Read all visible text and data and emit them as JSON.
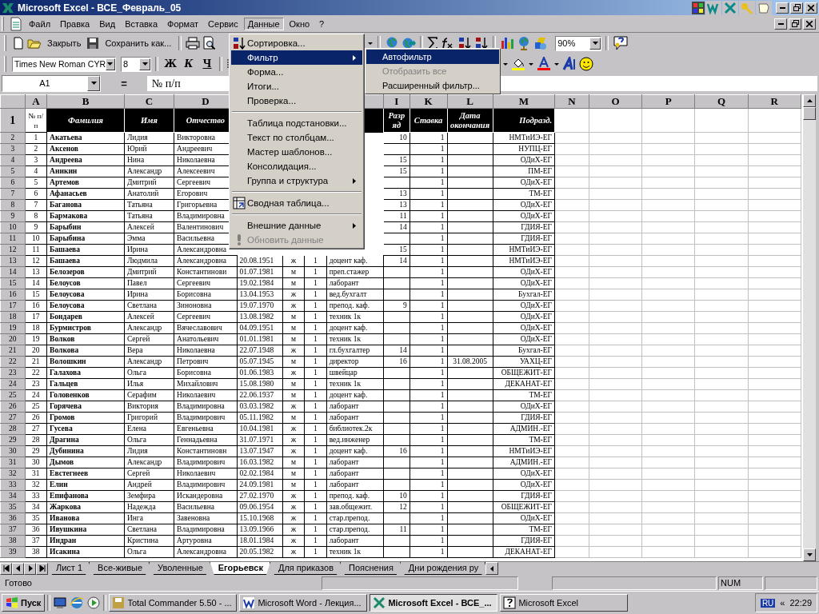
{
  "window": {
    "title": "Microsoft Excel - ВСЕ_Февраль_05"
  },
  "menu_bar": [
    {
      "label": "Файл",
      "selected": false
    },
    {
      "label": "Правка",
      "selected": false
    },
    {
      "label": "Вид",
      "selected": false
    },
    {
      "label": "Вставка",
      "selected": false
    },
    {
      "label": "Формат",
      "selected": false
    },
    {
      "label": "Сервис",
      "selected": false
    },
    {
      "label": "Данные",
      "selected": true
    },
    {
      "label": "Окно",
      "selected": false
    },
    {
      "label": "?",
      "selected": false
    }
  ],
  "standard_toolbar": {
    "close_label": "Закрыть",
    "save_as_label": "Сохранить как...",
    "zoom": "90%"
  },
  "formatting_toolbar": {
    "font": "Times New Roman CYR",
    "size": "8",
    "bold": "Ж",
    "italic": "К",
    "underline": "Ч"
  },
  "formula_bar": {
    "name_box": "A1",
    "equals": "=",
    "content": "№ п/п"
  },
  "sheet": {
    "column_letters_left": [
      "A",
      "B",
      "C",
      "D"
    ],
    "column_letters_right": [
      "I",
      "K",
      "L",
      "M",
      "N",
      "O",
      "P",
      "Q",
      "R"
    ],
    "header_row": {
      "number": "1",
      "cells": [
        "№ п/п",
        "Фамилия",
        "Имя",
        "Отчество",
        null,
        null,
        null,
        null,
        "Разряд",
        "Ставка",
        "Дата окончания",
        "Подразд."
      ]
    },
    "rows": [
      {
        "number": "2",
        "cells": [
          "1",
          "Акатьева",
          "Лидия",
          "Викторовна",
          null,
          null,
          null,
          null,
          "10",
          "1",
          null,
          "НМТиИЭ-ЕГ"
        ]
      },
      {
        "number": "3",
        "cells": [
          "2",
          "Аксенов",
          "Юрий",
          "Андреевич",
          null,
          null,
          null,
          null,
          null,
          "1",
          null,
          "НУПЦ-ЕГ"
        ]
      },
      {
        "number": "4",
        "cells": [
          "3",
          "Андреева",
          "Нина",
          "Николаевна",
          null,
          null,
          null,
          null,
          "15",
          "1",
          null,
          "ОДиХ-ЕГ"
        ]
      },
      {
        "number": "5",
        "cells": [
          "4",
          "Аникин",
          "Александр",
          "Алексеевич",
          null,
          null,
          null,
          null,
          "15",
          "1",
          null,
          "ПМ-ЕГ"
        ]
      },
      {
        "number": "6",
        "cells": [
          "5",
          "Артемов",
          "Дмитрий",
          "Сергеевич",
          null,
          null,
          null,
          null,
          null,
          "1",
          null,
          "ОДиХ-ЕГ"
        ]
      },
      {
        "number": "7",
        "cells": [
          "6",
          "Афанасьев",
          "Анатолий",
          "Егорович",
          null,
          null,
          null,
          null,
          "13",
          "1",
          null,
          "ТМ-ЕГ"
        ]
      },
      {
        "number": "8",
        "cells": [
          "7",
          "Баганова",
          "Татьяна",
          "Григорьевна",
          null,
          null,
          null,
          null,
          "13",
          "1",
          null,
          "ОДиХ-ЕГ"
        ]
      },
      {
        "number": "9",
        "cells": [
          "8",
          "Бармакова",
          "Татьяна",
          "Владимировна",
          null,
          null,
          null,
          null,
          "11",
          "1",
          null,
          "ОДиХ-ЕГ"
        ]
      },
      {
        "number": "10",
        "cells": [
          "9",
          "Барыбин",
          "Алексей",
          "Валентинович",
          null,
          null,
          null,
          null,
          "14",
          "1",
          null,
          "ГДИЯ-ЕГ"
        ]
      },
      {
        "number": "11",
        "cells": [
          "10",
          "Барыбина",
          "Эмма",
          "Васильевна",
          null,
          null,
          null,
          null,
          null,
          "1",
          null,
          "ГДИЯ-ЕГ"
        ]
      },
      {
        "number": "12",
        "cells": [
          "11",
          "Башаева",
          "Ирина",
          "Александровна",
          null,
          null,
          null,
          null,
          "15",
          "1",
          null,
          "НМТиИЭ-ЕГ"
        ]
      },
      {
        "number": "13",
        "cells": [
          "12",
          "Башаева",
          "Людмила",
          "Александровна",
          "20.08.1951",
          "ж",
          "1",
          "доцент каф.",
          "14",
          "1",
          null,
          "НМТиИЭ-ЕГ"
        ]
      },
      {
        "number": "14",
        "cells": [
          "13",
          "Белозеров",
          "Дмитрий",
          "Константинови",
          "01.07.1981",
          "м",
          "1",
          "преп.стажер",
          null,
          "1",
          null,
          "ОДиХ-ЕГ"
        ]
      },
      {
        "number": "15",
        "cells": [
          "14",
          "Белоусов",
          "Павел",
          "Сергеевич",
          "19.02.1984",
          "м",
          "1",
          "лаборант",
          null,
          "1",
          null,
          "ОДиХ-ЕГ"
        ]
      },
      {
        "number": "16",
        "cells": [
          "15",
          "Белоусова",
          "Ирина",
          "Борисовна",
          "13.04.1953",
          "ж",
          "1",
          "вед.бухгалт",
          null,
          "1",
          null,
          "Бухгал-ЕГ"
        ]
      },
      {
        "number": "17",
        "cells": [
          "16",
          "Белоусова",
          "Светлана",
          "Зиноновна",
          "19.07.1970",
          "ж",
          "1",
          "препод. каф.",
          "9",
          "1",
          null,
          "ОДиХ-ЕГ"
        ]
      },
      {
        "number": "18",
        "cells": [
          "17",
          "Бондарев",
          "Алексей",
          "Сергеевич",
          "13.08.1982",
          "м",
          "1",
          "техник 1к",
          null,
          "1",
          null,
          "ОДиХ-ЕГ"
        ]
      },
      {
        "number": "19",
        "cells": [
          "18",
          "Бурмистров",
          "Александр",
          "Вячеславович",
          "04.09.1951",
          "м",
          "1",
          "доцент каф.",
          null,
          "1",
          null,
          "ОДиХ-ЕГ"
        ]
      },
      {
        "number": "20",
        "cells": [
          "19",
          "Волков",
          "Сергей",
          "Анатольевич",
          "01.01.1981",
          "м",
          "1",
          "техник 1к",
          null,
          "1",
          null,
          "ОДиХ-ЕГ"
        ]
      },
      {
        "number": "21",
        "cells": [
          "20",
          "Волкова",
          "Вера",
          "Николаевна",
          "22.07.1948",
          "ж",
          "1",
          "гл.бухгалтер",
          "14",
          "1",
          null,
          "Бухгал-ЕГ"
        ]
      },
      {
        "number": "22",
        "cells": [
          "21",
          "Волошкин",
          "Александр",
          "Петрович",
          "05.07.1945",
          "м",
          "1",
          "директор",
          "16",
          "1",
          "31.08.2005",
          "УАХЦ-ЕГ"
        ]
      },
      {
        "number": "23",
        "cells": [
          "22",
          "Галахова",
          "Ольга",
          "Борисовна",
          "01.06.1983",
          "ж",
          "1",
          "швейцар",
          null,
          "1",
          null,
          "ОБЩЕЖИТ-ЕГ"
        ]
      },
      {
        "number": "24",
        "cells": [
          "23",
          "Гальцев",
          "Илья",
          "Михайлович",
          "15.08.1980",
          "м",
          "1",
          "техник 1к",
          null,
          "1",
          null,
          "ДЕКАНАТ-ЕГ"
        ]
      },
      {
        "number": "25",
        "cells": [
          "24",
          "Головенков",
          "Серафим",
          "Николаевич",
          "22.06.1937",
          "м",
          "1",
          "доцент каф.",
          null,
          "1",
          null,
          "ТМ-ЕГ"
        ]
      },
      {
        "number": "26",
        "cells": [
          "25",
          "Горячева",
          "Виктория",
          "Владимировна",
          "03.03.1982",
          "ж",
          "1",
          "лаборант",
          null,
          "1",
          null,
          "ОДиХ-ЕГ"
        ]
      },
      {
        "number": "27",
        "cells": [
          "26",
          "Громов",
          "Григорий",
          "Владимирович",
          "05.11.1982",
          "м",
          "1",
          "лаборант",
          null,
          "1",
          null,
          "ГДИЯ-ЕГ"
        ]
      },
      {
        "number": "28",
        "cells": [
          "27",
          "Гусева",
          "Елена",
          "Евгеньевна",
          "10.04.1981",
          "ж",
          "1",
          "библиотек.2к",
          null,
          "1",
          null,
          "АДМИН.-ЕГ"
        ]
      },
      {
        "number": "29",
        "cells": [
          "28",
          "Драгина",
          "Ольга",
          "Геннадьевна",
          "31.07.1971",
          "ж",
          "1",
          "вед.инженер",
          null,
          "1",
          null,
          "ТМ-ЕГ"
        ]
      },
      {
        "number": "30",
        "cells": [
          "29",
          "Дубинина",
          "Лидия",
          "Константиновн",
          "13.07.1947",
          "ж",
          "1",
          "доцент каф.",
          "16",
          "1",
          null,
          "НМТиИЭ-ЕГ"
        ]
      },
      {
        "number": "31",
        "cells": [
          "30",
          "Дымов",
          "Александр",
          "Владимирович",
          "16.03.1982",
          "м",
          "1",
          "лаборант",
          null,
          "1",
          null,
          "АДМИН.-ЕГ"
        ]
      },
      {
        "number": "32",
        "cells": [
          "31",
          "Евстегнеев",
          "Сергей",
          "Николаевич",
          "02.02.1984",
          "м",
          "1",
          "лаборант",
          null,
          "1",
          null,
          "ОДиХ-ЕГ"
        ]
      },
      {
        "number": "33",
        "cells": [
          "32",
          "Елин",
          "Андрей",
          "Владимирович",
          "24.09.1981",
          "м",
          "1",
          "лаборант",
          null,
          "1",
          null,
          "ОДиХ-ЕГ"
        ]
      },
      {
        "number": "34",
        "cells": [
          "33",
          "Епифанова",
          "Земфира",
          "Искандеровна",
          "27.02.1970",
          "ж",
          "1",
          "препод. каф.",
          "10",
          "1",
          null,
          "ГДИЯ-ЕГ"
        ]
      },
      {
        "number": "35",
        "cells": [
          "34",
          "Жаркова",
          "Надежда",
          "Васильевна",
          "09.06.1954",
          "ж",
          "1",
          "зав.общежит.",
          "12",
          "1",
          null,
          "ОБЩЕЖИТ-ЕГ"
        ]
      },
      {
        "number": "36",
        "cells": [
          "35",
          "Иванова",
          "Инга",
          "Завеновна",
          "15.10.1968",
          "ж",
          "1",
          "стар.препод.",
          null,
          "1",
          null,
          "ОДиХ-ЕГ"
        ]
      },
      {
        "number": "37",
        "cells": [
          "36",
          "Ивушкина",
          "Светлана",
          "Владимировна",
          "13.09.1966",
          "ж",
          "1",
          "стар.препод.",
          "11",
          "1",
          null,
          "ТМ-ЕГ"
        ]
      },
      {
        "number": "38",
        "cells": [
          "37",
          "Индран",
          "Кристина",
          "Артуровна",
          "18.01.1984",
          "ж",
          "1",
          "лаборант",
          null,
          "1",
          null,
          "ГДИЯ-ЕГ"
        ]
      },
      {
        "number": "39",
        "cells": [
          "38",
          "Исакина",
          "Ольга",
          "Александровна",
          "20.05.1982",
          "ж",
          "1",
          "техник 1к",
          null,
          "1",
          null,
          "ДЕКАНАТ-ЕГ"
        ]
      }
    ]
  },
  "data_menu": [
    {
      "kind": "item",
      "label": "Сортировка...",
      "icon": true,
      "selected": false,
      "disabled": false,
      "submenu": false
    },
    {
      "kind": "item",
      "label": "Фильтр",
      "icon": false,
      "selected": true,
      "disabled": false,
      "submenu": true
    },
    {
      "kind": "item",
      "label": "Форма...",
      "icon": false,
      "selected": false,
      "disabled": false,
      "submenu": false
    },
    {
      "kind": "item",
      "label": "Итоги...",
      "icon": false,
      "selected": false,
      "disabled": false,
      "submenu": false
    },
    {
      "kind": "item",
      "label": "Проверка...",
      "icon": false,
      "selected": false,
      "disabled": false,
      "submenu": false
    },
    {
      "kind": "separator"
    },
    {
      "kind": "item",
      "label": "Таблица подстановки...",
      "icon": false,
      "selected": false,
      "disabled": false,
      "submenu": false
    },
    {
      "kind": "item",
      "label": "Текст по столбцам...",
      "icon": false,
      "selected": false,
      "disabled": false,
      "submenu": false
    },
    {
      "kind": "item",
      "label": "Мастер шаблонов...",
      "icon": false,
      "selected": false,
      "disabled": false,
      "submenu": false
    },
    {
      "kind": "item",
      "label": "Консолидация...",
      "icon": false,
      "selected": false,
      "disabled": false,
      "submenu": false
    },
    {
      "kind": "item",
      "label": "Группа и структура",
      "icon": false,
      "selected": false,
      "disabled": false,
      "submenu": true
    },
    {
      "kind": "separator"
    },
    {
      "kind": "item",
      "label": "Сводная таблица...",
      "icon": true,
      "selected": false,
      "disabled": false,
      "submenu": false
    },
    {
      "kind": "separator"
    },
    {
      "kind": "item",
      "label": "Внешние данные",
      "icon": false,
      "selected": false,
      "disabled": false,
      "submenu": true
    },
    {
      "kind": "item",
      "label": "Обновить данные",
      "icon": true,
      "selected": false,
      "disabled": true,
      "submenu": false
    }
  ],
  "filter_submenu": [
    {
      "label": "Автофильтр",
      "selected": true,
      "disabled": false
    },
    {
      "label": "Отобразить все",
      "selected": false,
      "disabled": true
    },
    {
      "label": "Расширенный фильтр...",
      "selected": false,
      "disabled": false
    }
  ],
  "sheet_tabs": [
    {
      "label": "Лист 1",
      "selected": false
    },
    {
      "label": "Все-живые",
      "selected": false
    },
    {
      "label": "Уволенные",
      "selected": false
    },
    {
      "label": "Егорьевск",
      "selected": true
    },
    {
      "label": "Для приказов",
      "selected": false
    },
    {
      "label": "Пояснения",
      "selected": false
    },
    {
      "label": "Дни рождения ру",
      "selected": false
    }
  ],
  "status_bar": {
    "text": "Готово",
    "num": "NUM"
  },
  "taskbar": {
    "start": "Пуск",
    "tasks": [
      {
        "label": "Total Commander 5.50 - ...",
        "selected": false
      },
      {
        "label": "Microsoft Word - Лекция...",
        "selected": false
      },
      {
        "label": "Microsoft Excel - ВСЕ_...",
        "selected": true
      },
      {
        "label": "Microsoft Excel",
        "selected": false
      }
    ],
    "language": "RU",
    "expand": "«",
    "clock": "22:29"
  }
}
